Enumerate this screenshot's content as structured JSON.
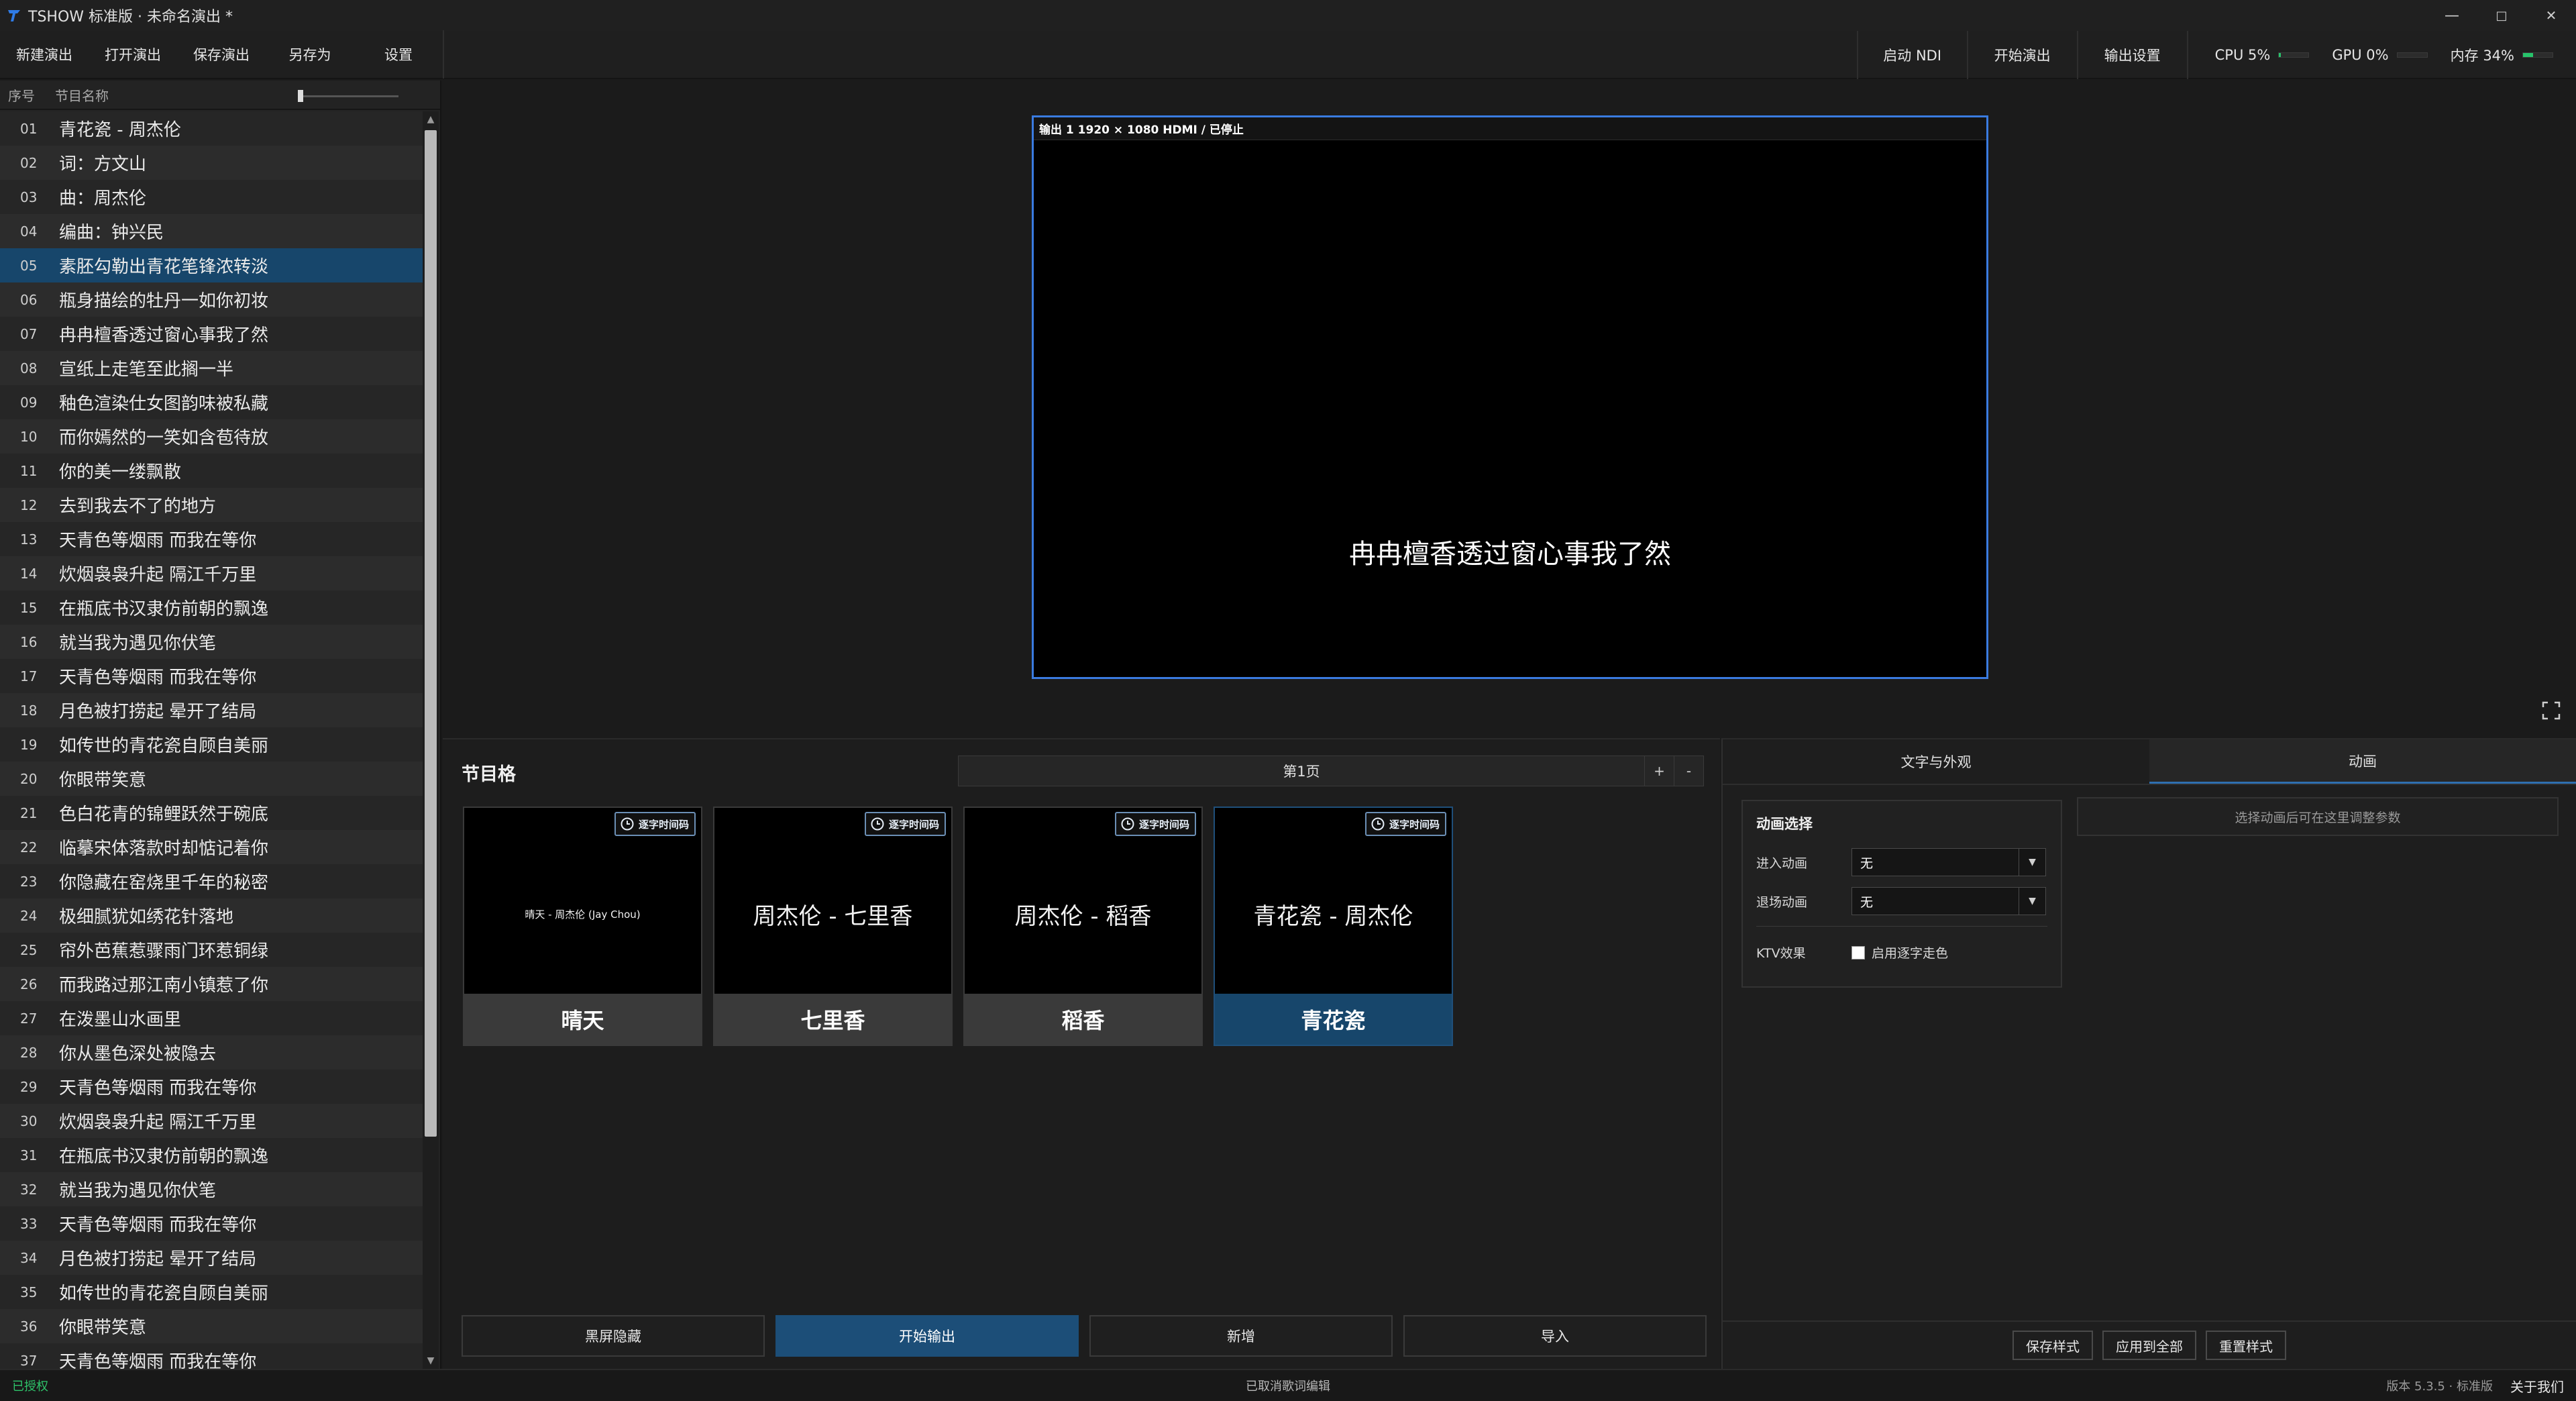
{
  "titlebar": {
    "title": "TSHOW 标准版 · 未命名演出 *",
    "minimize": "—",
    "maximize": "□",
    "close": "✕"
  },
  "toolbar": {
    "left": [
      "新建演出",
      "打开演出",
      "保存演出",
      "另存为",
      "设置"
    ],
    "right": [
      "启动 NDI",
      "开始演出",
      "输出设置"
    ],
    "meters": [
      {
        "label": "CPU 5%",
        "value": 0.05
      },
      {
        "label": "GPU 0%",
        "value": 0.0
      },
      {
        "label": "内存 34%",
        "value": 0.34
      }
    ],
    "meter_color": "#27c46b"
  },
  "song_list": {
    "header_num": "序号",
    "header_name": "节目名称",
    "selected_index": 4,
    "rows": [
      {
        "num": "01",
        "text": "青花瓷 - 周杰伦"
      },
      {
        "num": "02",
        "text": "词：方文山"
      },
      {
        "num": "03",
        "text": "曲：周杰伦"
      },
      {
        "num": "04",
        "text": "编曲：钟兴民"
      },
      {
        "num": "05",
        "text": "素胚勾勒出青花笔锋浓转淡"
      },
      {
        "num": "06",
        "text": "瓶身描绘的牡丹一如你初妆"
      },
      {
        "num": "07",
        "text": "冉冉檀香透过窗心事我了然"
      },
      {
        "num": "08",
        "text": "宣纸上走笔至此搁一半"
      },
      {
        "num": "09",
        "text": "釉色渲染仕女图韵味被私藏"
      },
      {
        "num": "10",
        "text": "而你嫣然的一笑如含苞待放"
      },
      {
        "num": "11",
        "text": "你的美一缕飘散"
      },
      {
        "num": "12",
        "text": "去到我去不了的地方"
      },
      {
        "num": "13",
        "text": "天青色等烟雨 而我在等你"
      },
      {
        "num": "14",
        "text": "炊烟袅袅升起 隔江千万里"
      },
      {
        "num": "15",
        "text": "在瓶底书汉隶仿前朝的飘逸"
      },
      {
        "num": "16",
        "text": "就当我为遇见你伏笔"
      },
      {
        "num": "17",
        "text": "天青色等烟雨 而我在等你"
      },
      {
        "num": "18",
        "text": "月色被打捞起 晕开了结局"
      },
      {
        "num": "19",
        "text": "如传世的青花瓷自顾自美丽"
      },
      {
        "num": "20",
        "text": "你眼带笑意"
      },
      {
        "num": "21",
        "text": "色白花青的锦鲤跃然于碗底"
      },
      {
        "num": "22",
        "text": "临摹宋体落款时却惦记着你"
      },
      {
        "num": "23",
        "text": "你隐藏在窑烧里千年的秘密"
      },
      {
        "num": "24",
        "text": "极细腻犹如绣花针落地"
      },
      {
        "num": "25",
        "text": "帘外芭蕉惹骤雨门环惹铜绿"
      },
      {
        "num": "26",
        "text": "而我路过那江南小镇惹了你"
      },
      {
        "num": "27",
        "text": "在泼墨山水画里"
      },
      {
        "num": "28",
        "text": "你从墨色深处被隐去"
      },
      {
        "num": "29",
        "text": "天青色等烟雨 而我在等你"
      },
      {
        "num": "30",
        "text": "炊烟袅袅升起 隔江千万里"
      },
      {
        "num": "31",
        "text": "在瓶底书汉隶仿前朝的飘逸"
      },
      {
        "num": "32",
        "text": "就当我为遇见你伏笔"
      },
      {
        "num": "33",
        "text": "天青色等烟雨 而我在等你"
      },
      {
        "num": "34",
        "text": "月色被打捞起 晕开了结局"
      },
      {
        "num": "35",
        "text": "如传世的青花瓷自顾自美丽"
      },
      {
        "num": "36",
        "text": "你眼带笑意"
      },
      {
        "num": "37",
        "text": "天青色等烟雨 而我在等你"
      }
    ]
  },
  "output": {
    "header": "输出 1  1920 × 1080  HDMI / 已停止",
    "lyric": "冉冉檀香透过窗心事我了然",
    "frame_color": "#3a7be0"
  },
  "program_grid": {
    "title": "节目格",
    "page_label": "第1页",
    "add": "+",
    "remove": "-",
    "cards": [
      {
        "badge": "逐字时间码",
        "preview": "晴天 - 周杰伦 (Jay Chou)",
        "label": "晴天",
        "small": true
      },
      {
        "badge": "逐字时间码",
        "preview": "周杰伦 - 七里香",
        "label": "七里香",
        "small": false
      },
      {
        "badge": "逐字时间码",
        "preview": "周杰伦 - 稻香",
        "label": "稻香",
        "small": false
      },
      {
        "badge": "逐字时间码",
        "preview": "青花瓷 - 周杰伦",
        "label": "青花瓷",
        "small": false
      }
    ],
    "active_card": 3,
    "actions": [
      "黑屏隐藏",
      "开始输出",
      "新增",
      "导入"
    ]
  },
  "properties": {
    "tabs": [
      "文字与外观",
      "动画"
    ],
    "active_tab": 1,
    "anim_title": "动画选择",
    "enter_label": "进入动画",
    "enter_value": "无",
    "exit_label": "退场动画",
    "exit_value": "无",
    "ktv_label": "KTV效果",
    "ktv_checkbox": "启用逐字走色",
    "hint": "选择动画后可在这里调整参数",
    "buttons": [
      "保存样式",
      "应用到全部",
      "重置样式"
    ]
  },
  "status": {
    "left": "已授权",
    "center": "已取消歌词编辑",
    "version": "版本 5.3.5 · 标准版",
    "about": "关于我们"
  }
}
